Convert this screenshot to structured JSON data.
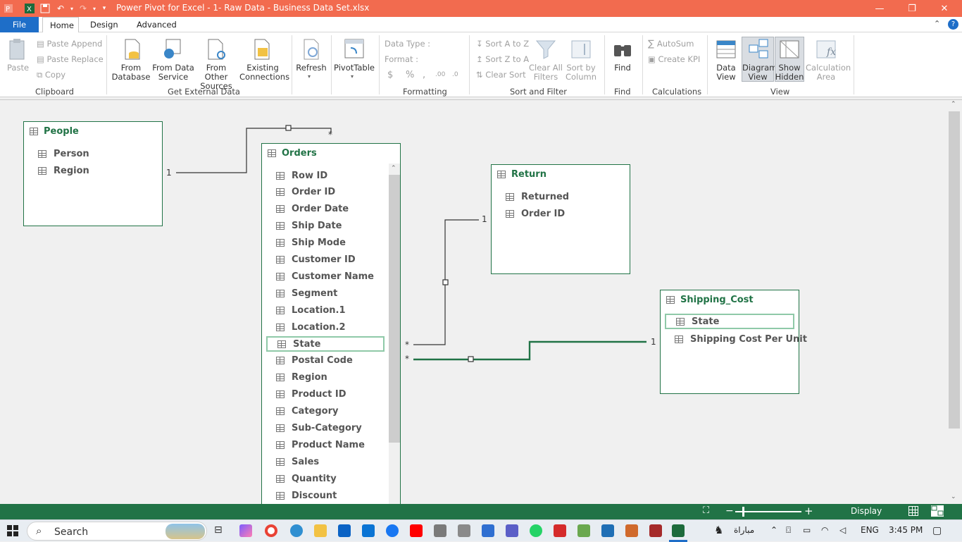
{
  "window": {
    "title": "Power Pivot for Excel - 1- Raw Data - Business Data Set.xlsx"
  },
  "tabs": [
    "File",
    "Home",
    "Design",
    "Advanced"
  ],
  "ribbon": {
    "clipboard": {
      "paste": "Paste",
      "paste_append": "Paste Append",
      "paste_replace": "Paste Replace",
      "copy": "Copy",
      "group": "Clipboard"
    },
    "external": {
      "from_database": "From\nDatabase",
      "from_data_service": "From Data\nService",
      "from_other_sources": "From Other\nSources",
      "existing_connections": "Existing\nConnections",
      "group": "Get External Data"
    },
    "refresh": "Refresh",
    "pivottable": "PivotTable",
    "formatting": {
      "data_type": "Data Type :",
      "format": "Format :",
      "group": "Formatting"
    },
    "sort": {
      "a_to_z": "Sort A to Z",
      "z_to_a": "Sort Z to A",
      "clear_sort": "Clear Sort",
      "clear_all_filters": "Clear All\nFilters",
      "sort_by_column": "Sort by\nColumn",
      "group": "Sort and Filter"
    },
    "find": {
      "label": "Find",
      "group": "Find"
    },
    "calculations": {
      "autosum": "AutoSum",
      "create_kpi": "Create KPI",
      "group": "Calculations"
    },
    "view": {
      "data_view": "Data\nView",
      "diagram_view": "Diagram\nView",
      "show_hidden": "Show\nHidden",
      "calculation_area": "Calculation\nArea",
      "group": "View"
    }
  },
  "tables": {
    "people": {
      "name": "People",
      "columns": [
        "Person",
        "Region"
      ]
    },
    "orders": {
      "name": "Orders",
      "columns": [
        "Row ID",
        "Order ID",
        "Order Date",
        "Ship Date",
        "Ship Mode",
        "Customer ID",
        "Customer Name",
        "Segment",
        "Location.1",
        "Location.2",
        "State",
        "Postal Code",
        "Region",
        "Product ID",
        "Category",
        "Sub-Category",
        "Product Name",
        "Sales",
        "Quantity",
        "Discount"
      ],
      "selected_column": "State"
    },
    "return": {
      "name": "Return",
      "columns": [
        "Returned",
        "Order ID"
      ]
    },
    "shipping": {
      "name": "Shipping_Cost",
      "columns": [
        "State",
        "Shipping Cost Per Unit"
      ],
      "selected_column": "State"
    }
  },
  "relationships": {
    "one": "1",
    "many": "*"
  },
  "statusbar": {
    "display": "Display"
  },
  "taskbar": {
    "search": "Search",
    "arabic_label": "مباراة",
    "lang": "ENG",
    "time": "3:45 PM"
  },
  "colors": {
    "title_bar": "#f26b4f",
    "accent_green": "#217346",
    "file_tab": "#1e6ec8"
  }
}
